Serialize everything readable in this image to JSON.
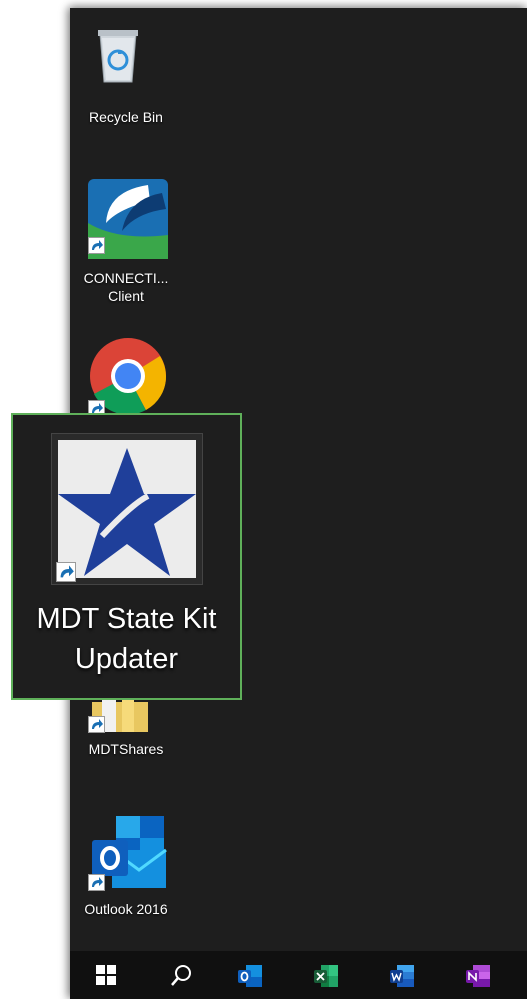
{
  "desktop": {
    "icons": [
      {
        "name": "recycle-bin",
        "label": "Recycle Bin"
      },
      {
        "name": "connect-client",
        "label_line1": "CONNECTI...",
        "label_line2": "Client"
      },
      {
        "name": "chrome",
        "label": ""
      },
      {
        "name": "mdtshares",
        "label": "MDTShares"
      },
      {
        "name": "outlook-2016",
        "label": "Outlook 2016"
      }
    ]
  },
  "zoom_callout": {
    "label_line1": "MDT State Kit",
    "label_line2": "Updater",
    "border_color": "#5fb05a",
    "icon": "blue-star-icon"
  },
  "taskbar": {
    "buttons": [
      {
        "name": "start",
        "icon": "windows-logo-icon"
      },
      {
        "name": "search",
        "icon": "search-icon"
      },
      {
        "name": "outlook",
        "icon": "outlook-icon"
      },
      {
        "name": "excel",
        "icon": "excel-icon"
      },
      {
        "name": "word",
        "icon": "word-icon"
      },
      {
        "name": "onenote",
        "icon": "onenote-icon"
      }
    ]
  },
  "colors": {
    "desktop_bg": "#1e1e1e",
    "taskbar_bg": "#101010",
    "highlight": "#5fb05a"
  }
}
